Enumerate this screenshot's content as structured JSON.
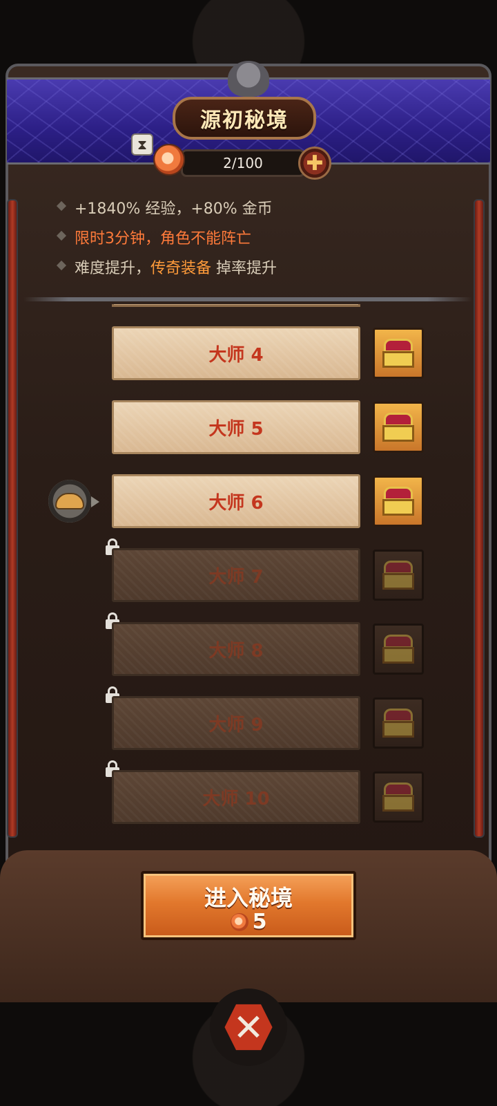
{
  "header": {
    "title": "源初秘境",
    "stamina": "2/100",
    "plus_icon": "plus-icon",
    "hourglass_icon": "hourglass-icon",
    "meat_icon": "meat-stamina-icon"
  },
  "info": {
    "line1": "+1840% 经验，+80% 金币",
    "line2": "限时3分钟，角色不能阵亡",
    "line3_pre": "难度提升，",
    "line3_highlight": "传奇装备",
    "line3_post": " 掉率提升"
  },
  "levels": [
    {
      "label": "大师 4",
      "locked": false
    },
    {
      "label": "大师 5",
      "locked": false
    },
    {
      "label": "大师 6",
      "locked": false,
      "current": true
    },
    {
      "label": "大师 7",
      "locked": true
    },
    {
      "label": "大师 8",
      "locked": true
    },
    {
      "label": "大师 9",
      "locked": true
    },
    {
      "label": "大师 10",
      "locked": true
    }
  ],
  "enter_button": {
    "label": "进入秘境",
    "cost": "5"
  },
  "colors": {
    "accent_red": "#c4361e",
    "highlight_orange": "#ff9b3a",
    "banner_blue": "#2c1f86",
    "button_orange": "#e2782d"
  }
}
